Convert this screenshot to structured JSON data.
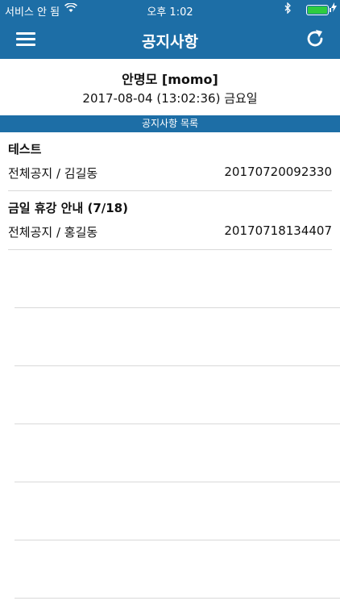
{
  "status_bar": {
    "carrier": "서비스 안 됨",
    "time": "오후 1:02",
    "icons": [
      "wifi-icon",
      "bluetooth-icon",
      "battery-icon",
      "charging-icon"
    ]
  },
  "nav": {
    "title": "공지사항",
    "menu_icon": "hamburger-menu-icon",
    "refresh_icon": "refresh-icon"
  },
  "user": {
    "name": "안명모 [momo]",
    "datetime": "2017-08-04 (13:02:36) 금요일"
  },
  "section": {
    "title": "공지사항 목록"
  },
  "notices": [
    {
      "title": "테스트",
      "meta": "전체공지 / 김길동",
      "timestamp": "20170720092330"
    },
    {
      "title": "금일 휴강 안내 (7/18)",
      "meta": "전체공지 / 홍길동",
      "timestamp": "20170718134407"
    }
  ],
  "colors": {
    "header": "#1d6ea6",
    "battery": "#2ecc40"
  }
}
